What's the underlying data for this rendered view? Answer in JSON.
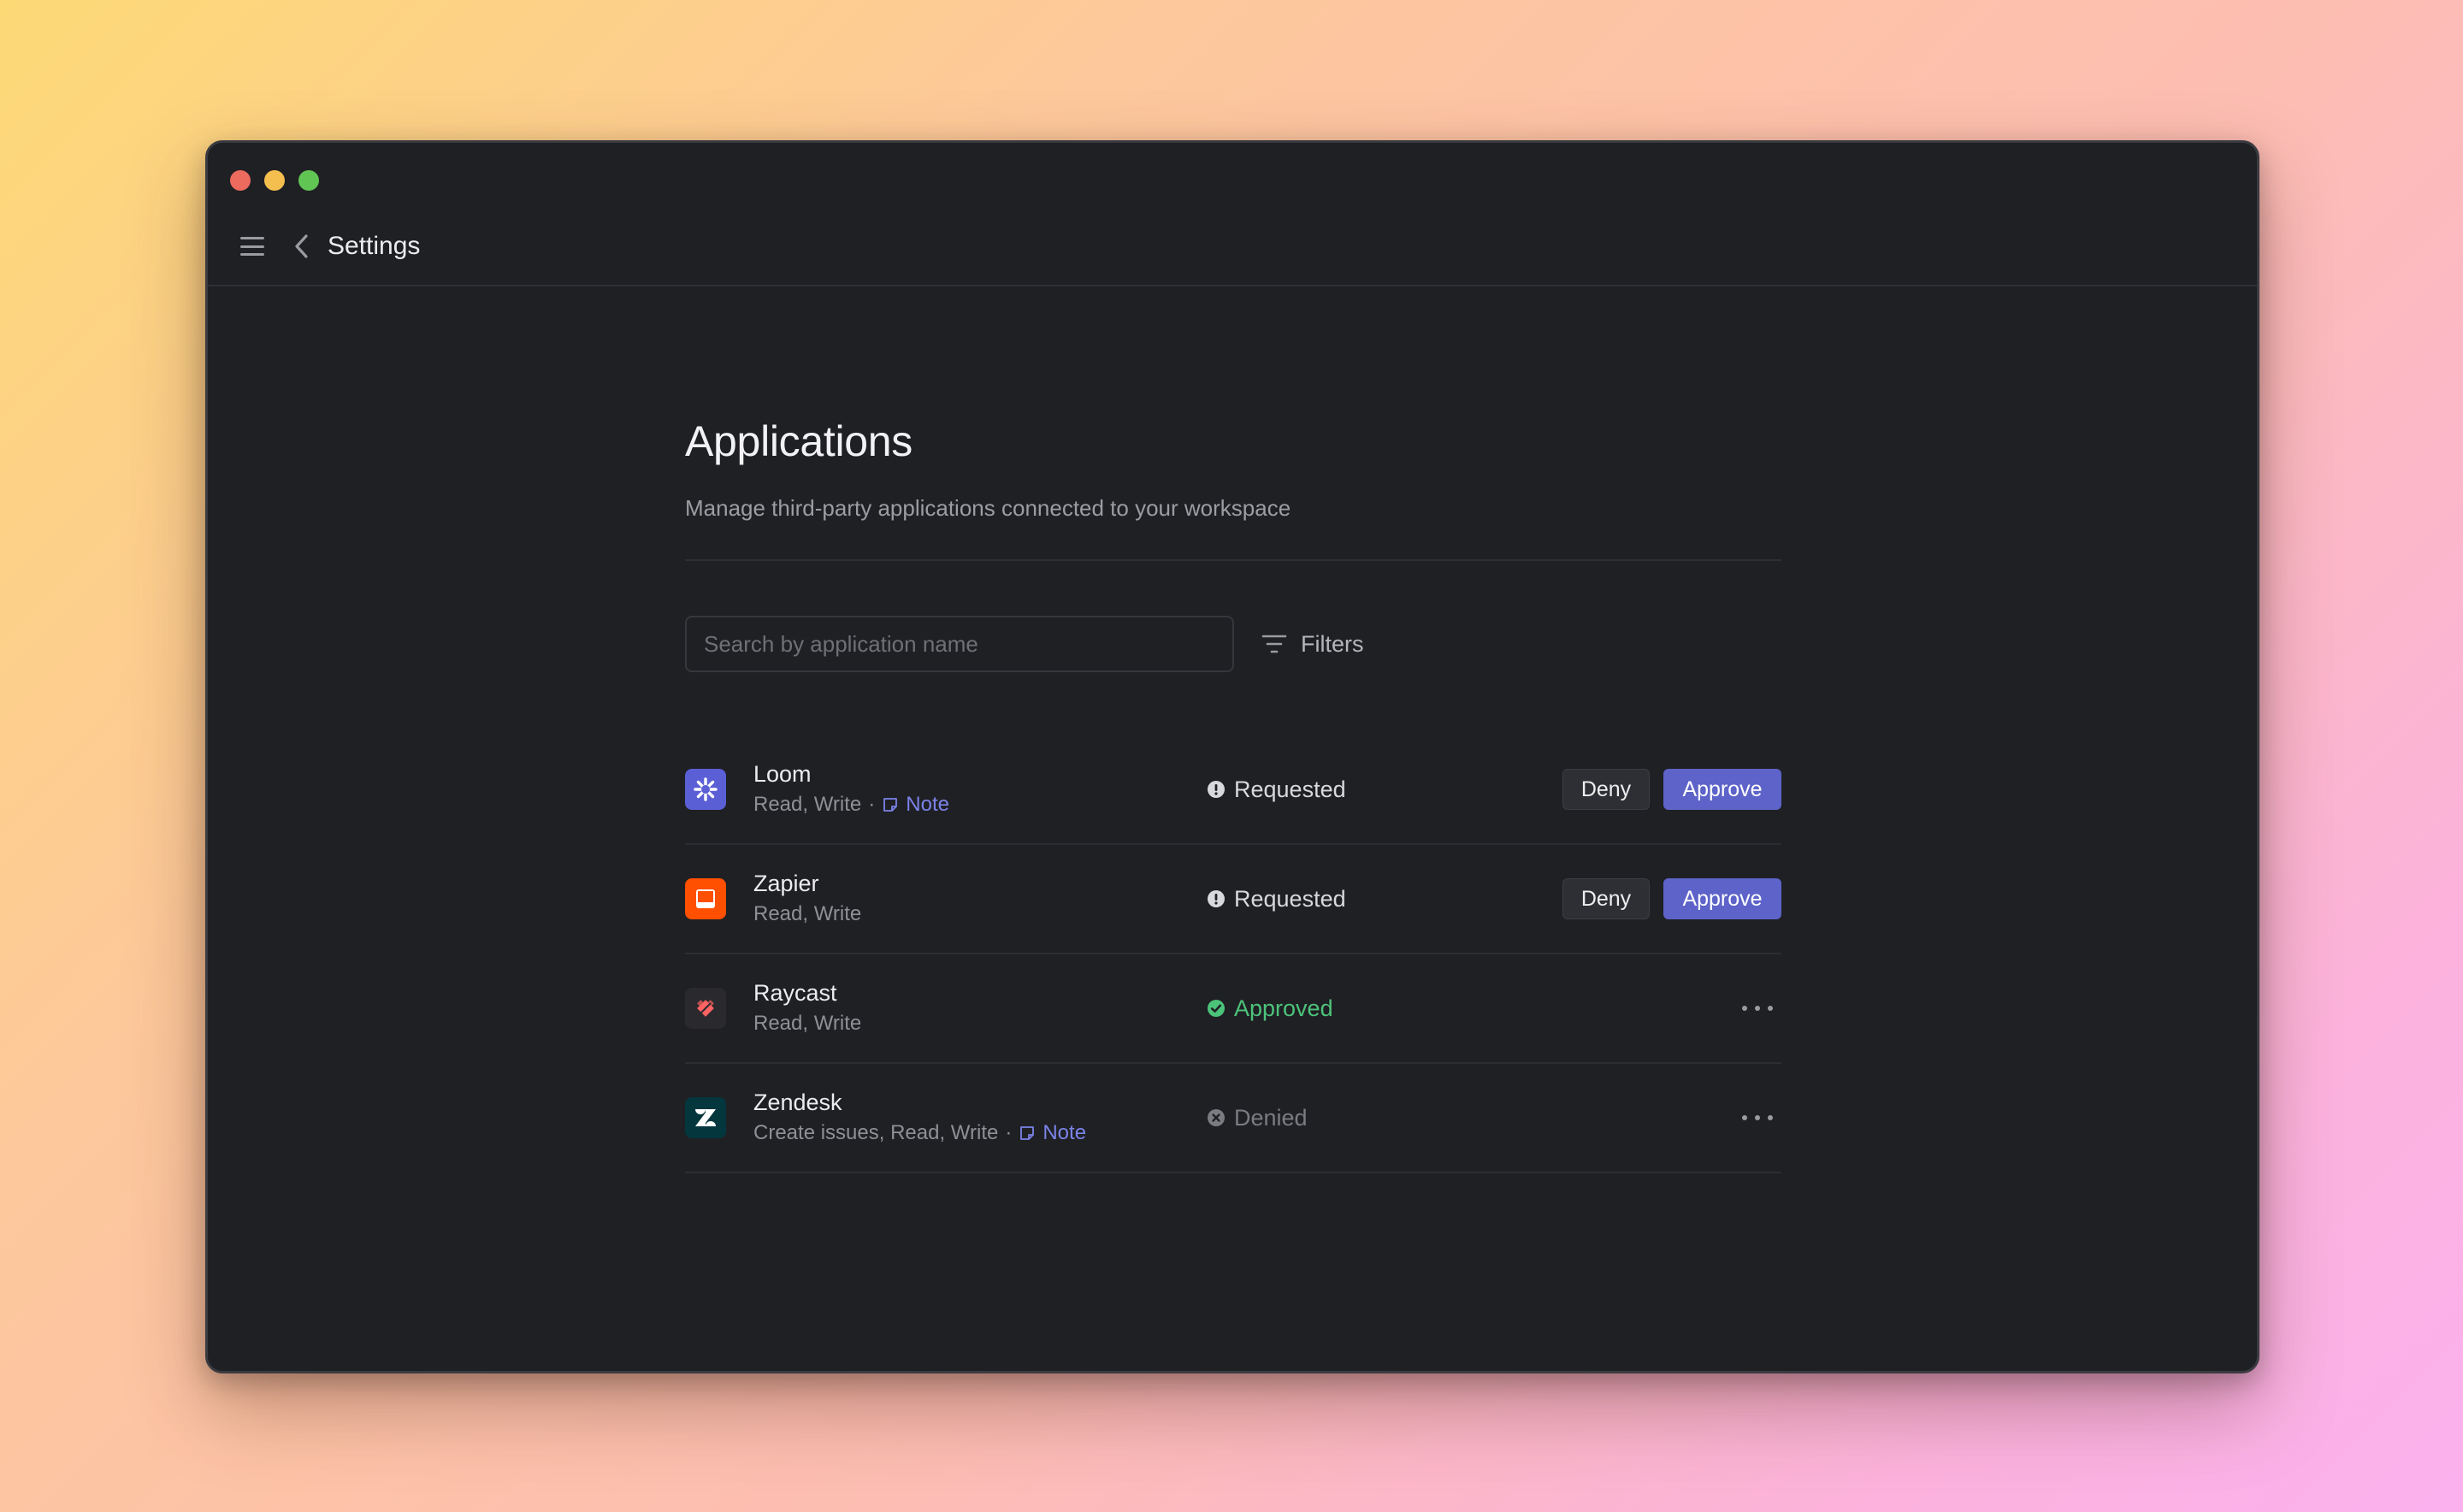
{
  "window": {
    "title": "Settings"
  },
  "page": {
    "title": "Applications",
    "subtitle": "Manage third-party applications connected to your workspace"
  },
  "search": {
    "placeholder": "Search by application name",
    "value": ""
  },
  "filters": {
    "label": "Filters"
  },
  "actions": {
    "deny_label": "Deny",
    "approve_label": "Approve"
  },
  "apps": [
    {
      "name": "Loom",
      "permissions": "Read, Write",
      "note": "Note",
      "status": "Requested",
      "icon": "loom-icon"
    },
    {
      "name": "Zapier",
      "permissions": "Read, Write",
      "note": "",
      "status": "Requested",
      "icon": "zapier-icon"
    },
    {
      "name": "Raycast",
      "permissions": "Read, Write",
      "note": "",
      "status": "Approved",
      "icon": "raycast-icon"
    },
    {
      "name": "Zendesk",
      "permissions": "Create issues, Read, Write",
      "note": "Note",
      "status": "Denied",
      "icon": "zendesk-icon"
    }
  ],
  "colors": {
    "accent": "#5d63c8",
    "link": "#7b83e8",
    "approved": "#4cc37a",
    "denied": "#7b7c82",
    "loom": "#5b5fd6",
    "zapier": "#ff4f00",
    "raycast": "#ff6363",
    "zendesk": "#03363d"
  }
}
